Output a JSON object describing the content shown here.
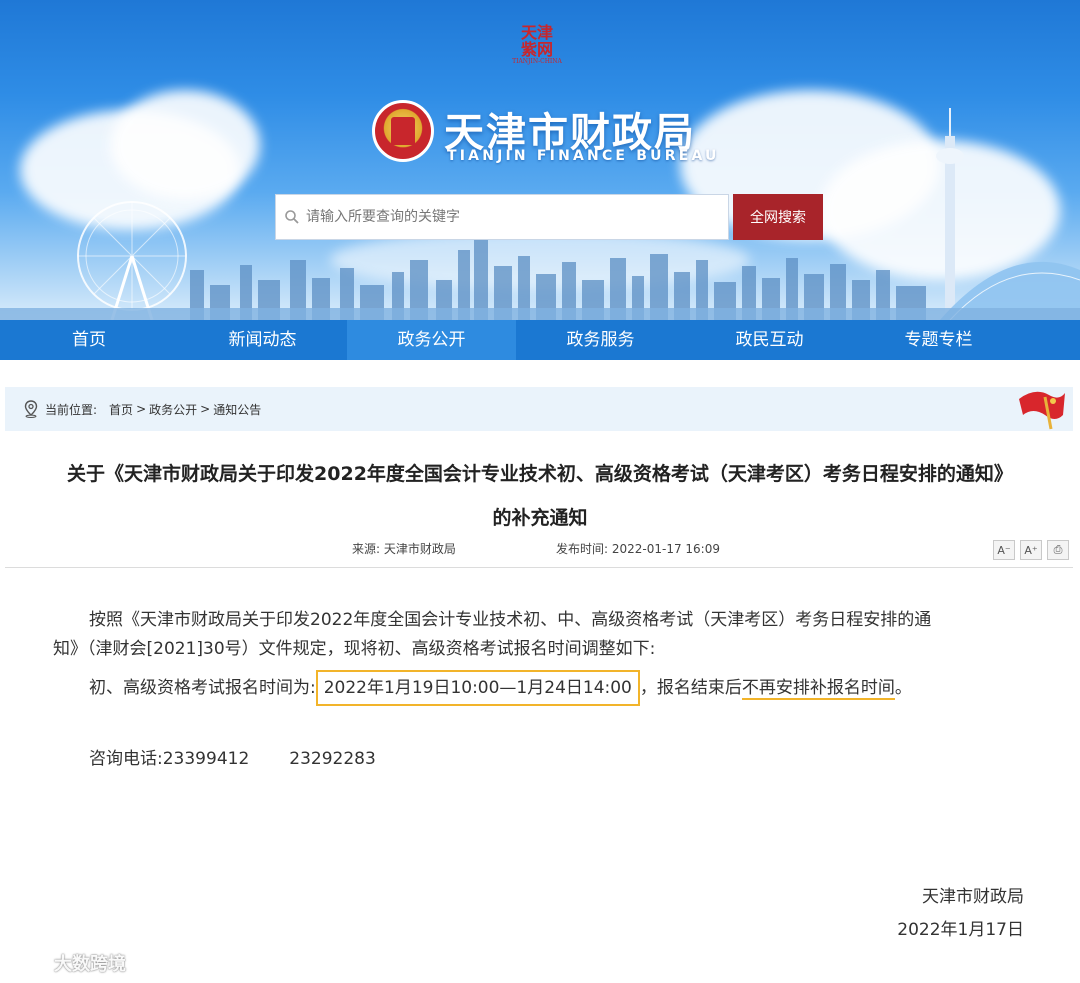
{
  "header": {
    "seal_text": "天津紫网",
    "seal_sub": "TIANJIN-CHINA",
    "site_title": "天津市财政局",
    "site_subtitle": "TIANJIN FINANCE BUREAU",
    "search_placeholder": "请输入所要查询的关键字",
    "search_button": "全网搜索"
  },
  "nav": {
    "items": [
      "首页",
      "新闻动态",
      "政务公开",
      "政务服务",
      "政民互动",
      "专题专栏"
    ],
    "active_index": 2
  },
  "breadcrumb": {
    "label": "当前位置:",
    "items": [
      "首页",
      "政务公开",
      "通知公告"
    ],
    "separator": ">"
  },
  "article": {
    "title_line1": "关于《天津市财政局关于印发2022年度全国会计专业技术初、高级资格考试（天津考区）考务日程安排的通知》",
    "title_line2": "的补充通知",
    "source": "来源:  天津市财政局",
    "published": "发布时间:  2022-01-17 16:09",
    "tools": [
      "A⁻",
      "A⁺",
      "⎙"
    ],
    "para1_line1": "按照《天津市财政局关于印发2022年度全国会计专业技术初、中、高级资格考试（天津考区）考务日程安排的通",
    "para1_line2": "知》（津财会[2021]30号）文件规定，现将初、高级资格考试报名时间调整如下:",
    "para2_prefix": "初、高级资格考试报名时间为:",
    "para2_highlight": "2022年1月19日10:00—1月24日14:00",
    "para2_middle": "，报名结束后",
    "para2_underline": "不再安排补报名时间",
    "para2_end": "。",
    "phone_label": "咨询电话:",
    "phone_1": "23399412",
    "phone_2": "23292283",
    "signer": "天津市财政局",
    "sign_date": "2022年1月17日"
  },
  "watermark": "大数跨境",
  "colors": {
    "nav_bg": "#1b78d2",
    "search_button_bg": "#a8242a",
    "highlight": "#f2b42a",
    "breadcrumb_bg": "#eaf3fb"
  }
}
